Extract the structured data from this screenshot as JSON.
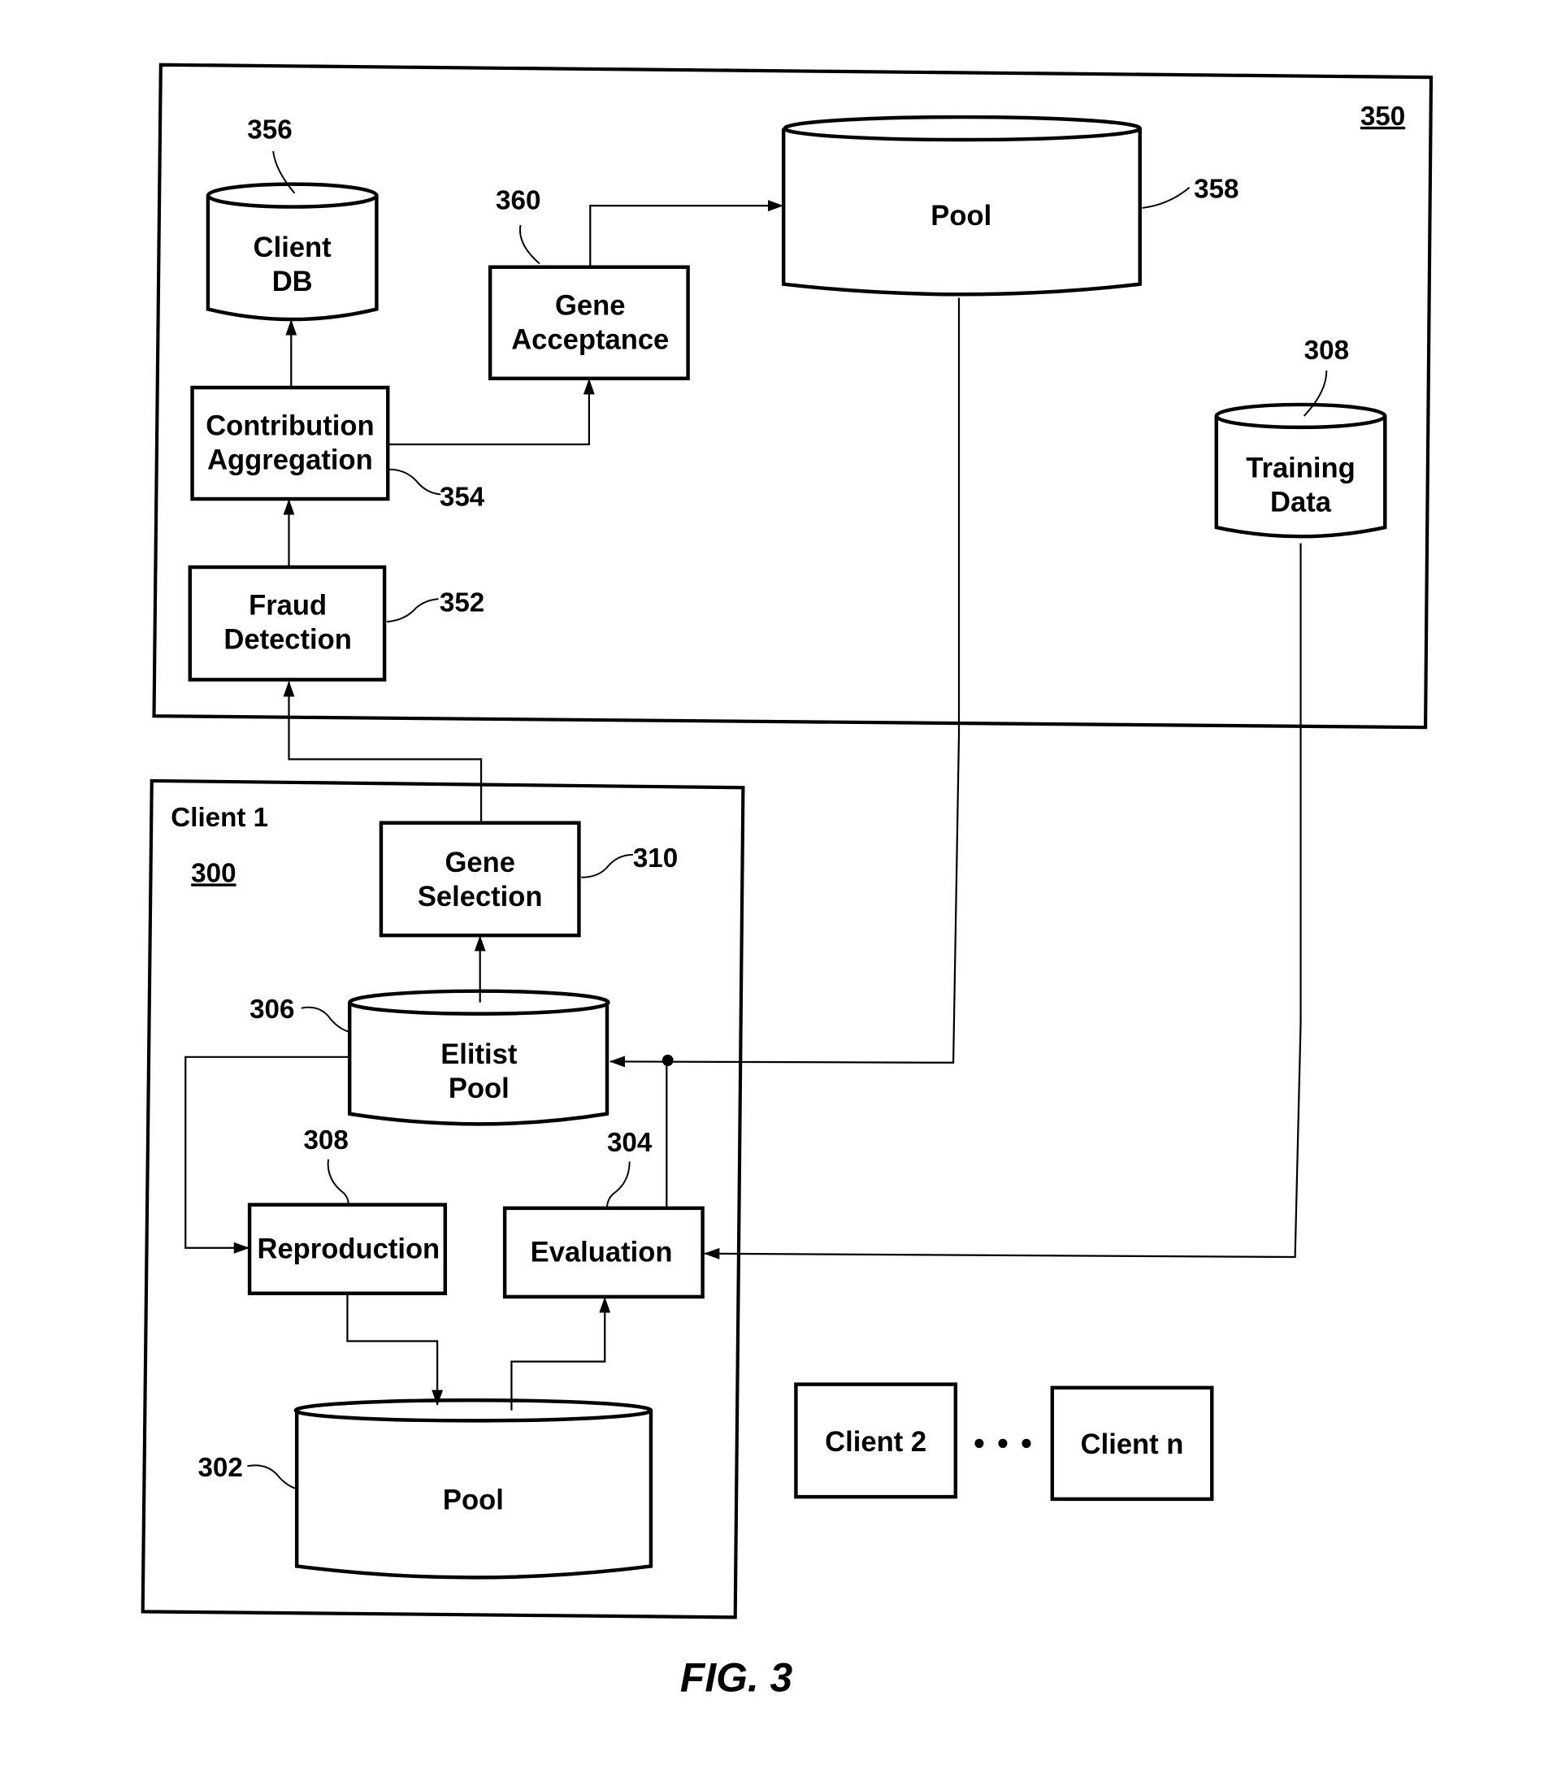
{
  "figure": {
    "caption": "FIG. 3",
    "server": {
      "ref": "350",
      "client_db": {
        "ref": "356",
        "line1": "Client",
        "line2": "DB"
      },
      "gene_acceptance": {
        "ref": "360",
        "line1": "Gene",
        "line2": "Acceptance"
      },
      "pool": {
        "ref": "358",
        "label": "Pool"
      },
      "contribution_aggregation": {
        "ref": "354",
        "line1": "Contribution",
        "line2": "Aggregation"
      },
      "fraud_detection": {
        "ref": "352",
        "line1": "Fraud",
        "line2": "Detection"
      },
      "training_data": {
        "ref": "308",
        "line1": "Training",
        "line2": "Data"
      }
    },
    "client1": {
      "title": "Client 1",
      "ref": "300",
      "gene_selection": {
        "ref": "310",
        "line1": "Gene",
        "line2": "Selection"
      },
      "elitist_pool": {
        "ref": "306",
        "line1": "Elitist",
        "line2": "Pool"
      },
      "reproduction": {
        "ref": "308",
        "label": "Reproduction"
      },
      "evaluation": {
        "ref": "304",
        "label": "Evaluation"
      },
      "pool": {
        "ref": "302",
        "label": "Pool"
      }
    },
    "other_clients": {
      "client2": "Client 2",
      "ellipsis": "• • •",
      "clientn": "Client n"
    }
  }
}
